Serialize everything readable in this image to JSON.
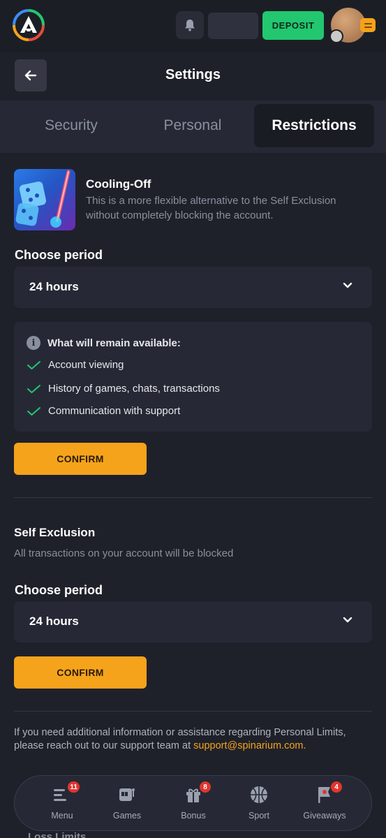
{
  "header": {
    "deposit_label": "DEPOSIT",
    "brand_colors": {
      "deposit": "#22c770",
      "accent": "#f6a31c"
    }
  },
  "titlebar": {
    "title": "Settings"
  },
  "tabs": [
    {
      "label": "Security",
      "active": false
    },
    {
      "label": "Personal",
      "active": false
    },
    {
      "label": "Restrictions",
      "active": true
    }
  ],
  "cooling_off": {
    "title": "Cooling-Off",
    "description": "This is a more flexible alternative to the Self Exclusion without completely blocking the account.",
    "period_label": "Choose period",
    "period_value": "24 hours",
    "info_title": "What will remain available:",
    "info_items": [
      "Account viewing",
      "History of games, chats, transactions",
      "Communication with support"
    ],
    "confirm_label": "CONFIRM"
  },
  "self_exclusion": {
    "title": "Self Exclusion",
    "description": "All transactions on your account will be blocked",
    "period_label": "Choose period",
    "period_value": "24 hours",
    "confirm_label": "CONFIRM"
  },
  "support": {
    "text": "If you need additional information or assistance regarding Personal Limits, please reach out to our support team at",
    "email": "support@spinarium.com."
  },
  "cut_off_text": "Loss Limits",
  "bottom_nav": [
    {
      "label": "Menu",
      "icon": "menu-icon",
      "badge": "11"
    },
    {
      "label": "Games",
      "icon": "slot-machine-icon",
      "badge": ""
    },
    {
      "label": "Bonus",
      "icon": "gift-icon",
      "badge": "8"
    },
    {
      "label": "Sport",
      "icon": "basketball-icon",
      "badge": ""
    },
    {
      "label": "Giveaways",
      "icon": "giveaway-flag-icon",
      "badge": "4"
    }
  ]
}
